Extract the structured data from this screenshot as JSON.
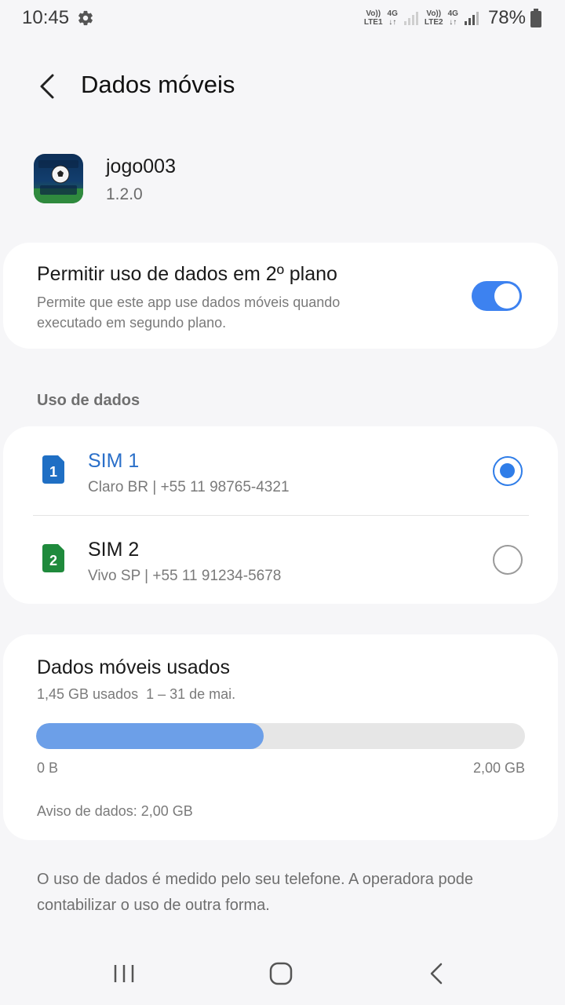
{
  "status_bar": {
    "time": "10:45",
    "sim1_volte": "Vo))",
    "sim1_lte": "LTE1",
    "sim1_net": "4G",
    "sim2_volte": "Vo))",
    "sim2_lte": "LTE2",
    "sim2_net": "4G",
    "battery": "78%"
  },
  "header": {
    "title": "Dados móveis"
  },
  "app": {
    "name": "jogo003",
    "version": "1.2.0",
    "icon": "soccer-ball-icon"
  },
  "background_data": {
    "title": "Permitir uso de dados em 2º plano",
    "description": "Permite que este app use dados móveis quando executado em segundo plano.",
    "enabled": true
  },
  "section": {
    "label": "Uso de dados"
  },
  "sims": [
    {
      "name": "SIM 1",
      "badge": "1",
      "details": "Claro BR | +55 11 98765-4321",
      "selected": true,
      "color": "#1f6fc4"
    },
    {
      "name": "SIM 2",
      "badge": "2",
      "details": "Vivo SP | +55 11 91234-5678",
      "selected": false,
      "color": "#1f8a3c"
    }
  ],
  "usage": {
    "title": "Dados móveis usados",
    "used": "1,45 GB usados",
    "period": "1 – 31 de mai.",
    "fraction": 0.465,
    "min_label": "0 B",
    "max_label": "2,00 GB",
    "warning": "Aviso de dados: 2,00 GB"
  },
  "footer": {
    "note": "O uso de dados é medido pelo seu telefone. A operadora pode contabilizar o uso de outra forma."
  },
  "colors": {
    "accent": "#3d82f0",
    "bar_fill": "#6c9fe8"
  }
}
